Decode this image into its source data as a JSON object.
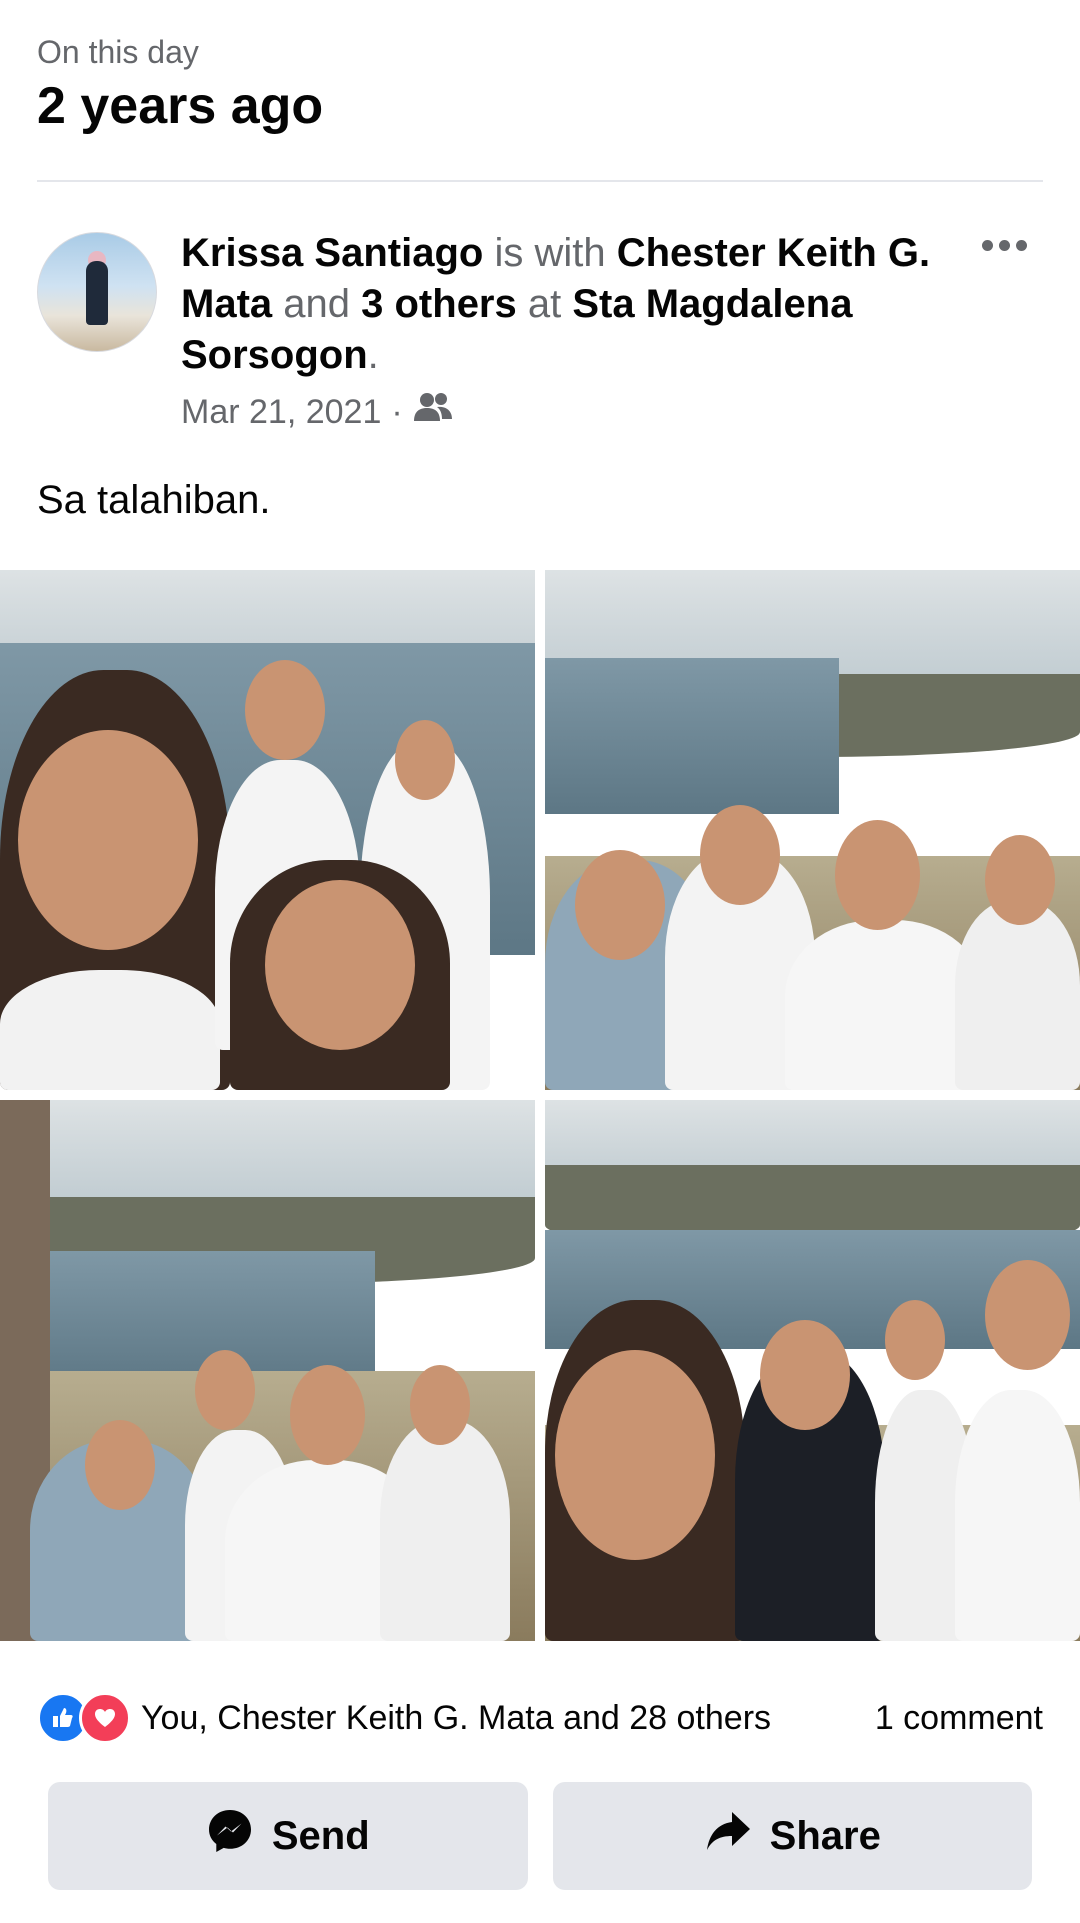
{
  "header": {
    "kicker": "On this day",
    "title": "2 years ago"
  },
  "post": {
    "author": "Krissa Santiago",
    "with_word": "is with",
    "tagged": "Chester Keith G. Mata",
    "and_word": "and",
    "others": "3 others",
    "at_word": "at",
    "place": "Sta Magdalena Sorsogon",
    "period": ".",
    "date": "Mar 21, 2021",
    "separator": "·",
    "audience_icon": "friends-icon",
    "more_icon": "more-options-icon",
    "caption": "Sa talahiban."
  },
  "photos": [
    {
      "name": "photo-1"
    },
    {
      "name": "photo-2"
    },
    {
      "name": "photo-3"
    },
    {
      "name": "photo-4"
    }
  ],
  "engagement": {
    "reactions_text": "You, Chester Keith G. Mata and 28 others",
    "comments_text": "1 comment",
    "like_icon": "like-reaction-icon",
    "love_icon": "love-reaction-icon"
  },
  "actions": {
    "send_label": "Send",
    "share_label": "Share"
  },
  "colors": {
    "accent": "#1877f2",
    "love": "#f33e58",
    "secondary_text": "#65676b",
    "button_bg": "#e4e6eb"
  }
}
